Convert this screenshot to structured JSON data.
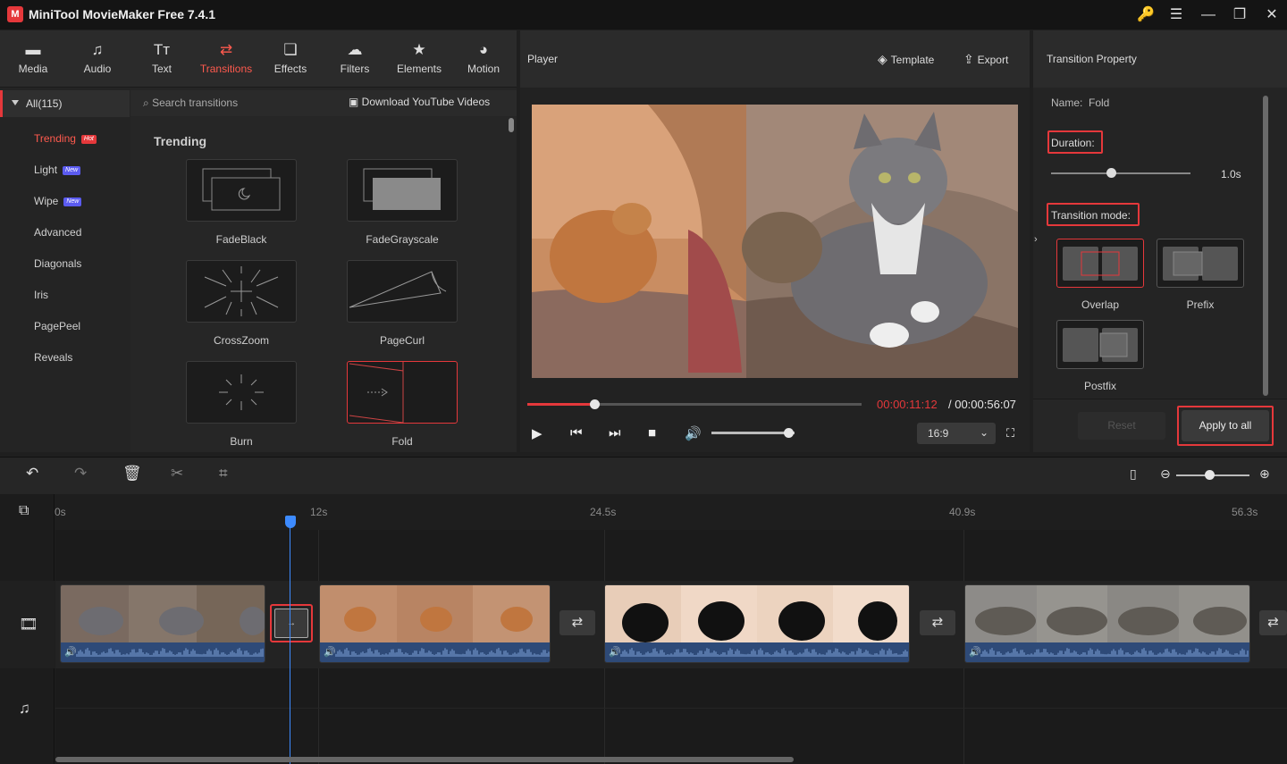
{
  "app": {
    "title": "MiniTool MovieMaker Free 7.4.1",
    "logo": "M"
  },
  "window_controls": [
    {
      "name": "key-icon",
      "glyph": "🔑"
    },
    {
      "name": "menu-icon",
      "glyph": "☰"
    },
    {
      "name": "minimize-icon",
      "glyph": "—"
    },
    {
      "name": "maximize-icon",
      "glyph": "❐"
    },
    {
      "name": "close-icon",
      "glyph": "✕"
    }
  ],
  "toolbar": {
    "tabs": [
      {
        "label": "Media",
        "icon": "▬"
      },
      {
        "label": "Audio",
        "icon": "♫"
      },
      {
        "label": "Text",
        "icon": "Tт"
      },
      {
        "label": "Transitions",
        "icon": "⇄",
        "active": true
      },
      {
        "label": "Effects",
        "icon": "❏"
      },
      {
        "label": "Filters",
        "icon": "☁"
      },
      {
        "label": "Elements",
        "icon": "★"
      },
      {
        "label": "Motion",
        "icon": "◕"
      }
    ]
  },
  "categories": {
    "all": "All(115)",
    "items": [
      {
        "label": "Trending",
        "badge": "Hot",
        "active": true
      },
      {
        "label": "Light",
        "badge": "New"
      },
      {
        "label": "Wipe",
        "badge": "New"
      },
      {
        "label": "Advanced"
      },
      {
        "label": "Diagonals"
      },
      {
        "label": "Iris"
      },
      {
        "label": "PagePeel"
      },
      {
        "label": "Reveals"
      }
    ]
  },
  "search": {
    "placeholder": "Search transitions",
    "download": "Download YouTube Videos"
  },
  "grid": {
    "heading": "Trending",
    "items": [
      "FadeBlack",
      "FadeGrayscale",
      "CrossZoom",
      "PageCurl",
      "Burn",
      "Fold"
    ],
    "selected": "Fold"
  },
  "player": {
    "title": "Player",
    "template": "Template",
    "export": "Export",
    "time_current": "00:00:11:12",
    "time_total": "/ 00:00:56:07",
    "progress": 0.2,
    "volume": 0.93,
    "ratio": "16:9"
  },
  "property": {
    "title": "Transition Property",
    "name_label": "Name:",
    "name_value": "Fold",
    "duration_label": "Duration:",
    "duration_value": "1.0s",
    "duration_level": 0.43,
    "mode_label": "Transition mode:",
    "modes": [
      "Overlap",
      "Prefix",
      "Postfix"
    ],
    "selected_mode": "Overlap",
    "reset": "Reset",
    "apply_all": "Apply to all"
  },
  "timeline": {
    "ruler": [
      "0s",
      "12s",
      "24.5s",
      "40.9s",
      "56.3s"
    ],
    "zoom_level": 0.45
  },
  "colors": {
    "accent": "#e5383b",
    "playhead": "#3d8bff",
    "audio": "#2e4a78"
  }
}
